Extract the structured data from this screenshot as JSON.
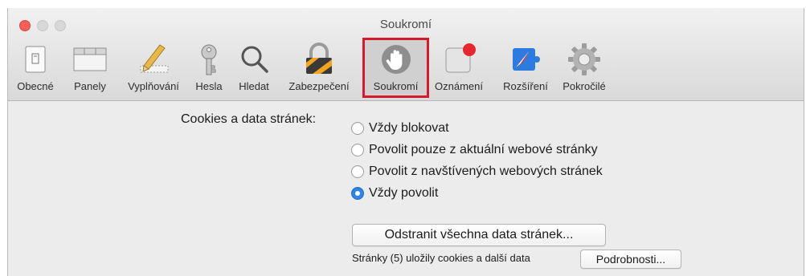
{
  "window": {
    "title": "Soukromí"
  },
  "toolbar": {
    "items": [
      {
        "label": "Obecné",
        "icon": "general-switch-icon"
      },
      {
        "label": "Panely",
        "icon": "tabs-icon"
      },
      {
        "label": "Vyplňování",
        "icon": "pencil-ruler-icon"
      },
      {
        "label": "Hesla",
        "icon": "key-icon"
      },
      {
        "label": "Hledat",
        "icon": "magnifier-icon"
      },
      {
        "label": "Zabezpečení",
        "icon": "padlock-icon"
      },
      {
        "label": "Soukromí",
        "icon": "hand-icon",
        "selected": true
      },
      {
        "label": "Oznámení",
        "icon": "notification-badge-icon"
      },
      {
        "label": "Rozšíření",
        "icon": "puzzle-compass-icon"
      },
      {
        "label": "Pokročilé",
        "icon": "gear-icon"
      }
    ]
  },
  "cookies": {
    "label": "Cookies a data stránek:",
    "options": [
      {
        "label": "Vždy blokovat",
        "selected": false
      },
      {
        "label": "Povolit pouze z aktuální webové stránky",
        "selected": false
      },
      {
        "label": "Povolit z navštívených webových stránek",
        "selected": false
      },
      {
        "label": "Vždy povolit",
        "selected": true
      }
    ],
    "remove_button": "Odstranit všechna data stránek...",
    "status_text": "Stránky (5) uložily cookies a další data",
    "details_button": "Podrobnosti..."
  },
  "colors": {
    "highlight": "#d8192c",
    "radio_selected": "#2e84e8",
    "close": "#fc5f57"
  }
}
